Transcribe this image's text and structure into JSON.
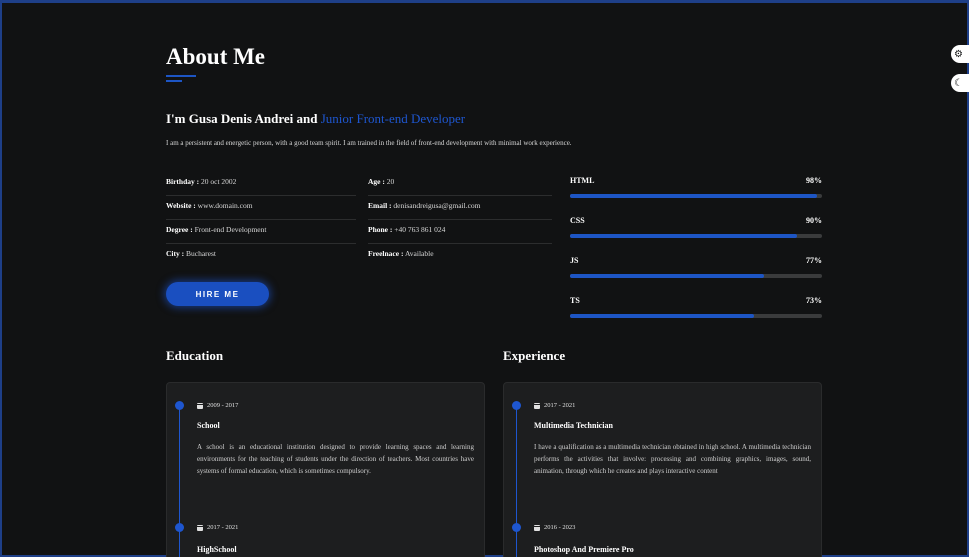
{
  "about": {
    "title": "About Me",
    "intro_name": "I'm Gusa Denis Andrei and",
    "intro_role": "Junior Front-end Developer",
    "intro_text": "I am a persistent and energetic person, with a good team spirit. I am trained in the field of front-end development with minimal work experience."
  },
  "info": {
    "left": [
      {
        "label": "Birthday :",
        "value": "20 oct 2002"
      },
      {
        "label": "Website :",
        "value": "www.domain.com"
      },
      {
        "label": "Degree :",
        "value": "Front-end Development"
      },
      {
        "label": "City :",
        "value": "Bucharest"
      }
    ],
    "right": [
      {
        "label": "Age :",
        "value": "20"
      },
      {
        "label": "Email :",
        "value": "denisandreigusa@gmail.com"
      },
      {
        "label": "Phone :",
        "value": "+40 763 861 024"
      },
      {
        "label": "Freelnace :",
        "value": "Available"
      }
    ]
  },
  "hire_button": "HIRE ME",
  "skills": [
    {
      "name": "HTML",
      "percent_label": "98%",
      "level": 0.98
    },
    {
      "name": "CSS",
      "percent_label": "90%",
      "level": 0.9
    },
    {
      "name": "JS",
      "percent_label": "77%",
      "level": 0.77
    },
    {
      "name": "TS",
      "percent_label": "73%",
      "level": 0.73
    }
  ],
  "education": {
    "title": "Education",
    "entries": [
      {
        "date": "2009 - 2017",
        "title": "School",
        "description": "A school is an educational institution designed to provide learning spaces and learning environments for the teaching of students under the direction of teachers. Most countries have systems of formal education, which is sometimes compulsory."
      },
      {
        "date": "2017 - 2021",
        "title": "HighSchool",
        "description": ""
      }
    ]
  },
  "experience": {
    "title": "Experience",
    "entries": [
      {
        "date": "2017 - 2021",
        "title": "Multimedia Technician",
        "description": "I have a qualification as a multimedia technician obtained in high school. A multimedia technician performs the activities that involve: processing and combining graphics, images, sound, animation, through which he creates and plays interactive content"
      },
      {
        "date": "2016 - 2023",
        "title": "Photoshop And Premiere Pro",
        "description": ""
      }
    ]
  },
  "side_controls": {
    "gear_icon": "gear-icon",
    "moon_icon": "moon-icon"
  },
  "colors": {
    "accent": "#1e56cf",
    "background": "#111213",
    "card": "#1d1e1f"
  }
}
